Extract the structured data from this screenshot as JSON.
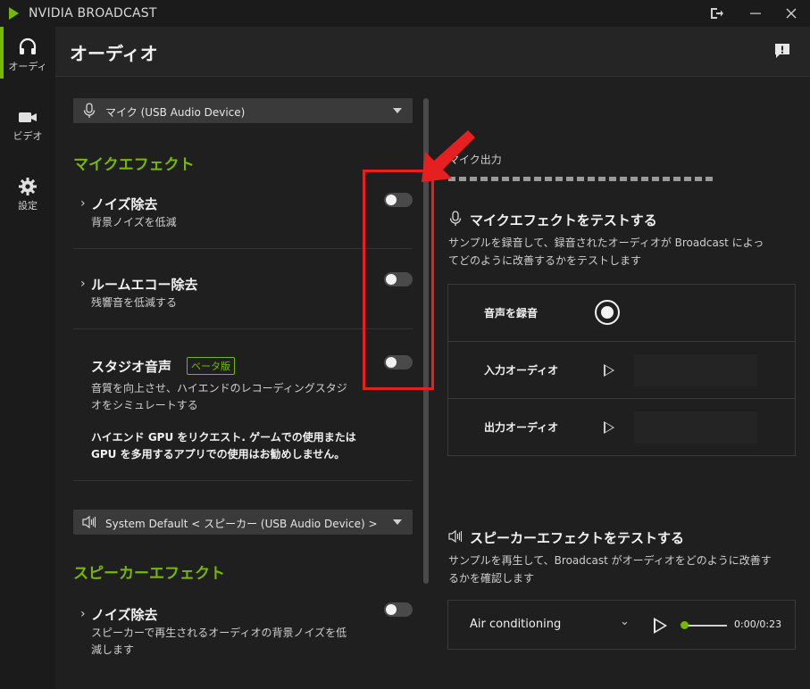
{
  "window": {
    "title": "NVIDIA BROADCAST"
  },
  "nav": {
    "items": [
      {
        "label": "オーディ",
        "icon": "headset-icon",
        "active": true
      },
      {
        "label": "ビデオ",
        "icon": "camera-icon",
        "active": false
      },
      {
        "label": "設定",
        "icon": "gear-icon",
        "active": false
      }
    ]
  },
  "header": {
    "title": "オーディオ"
  },
  "mic": {
    "device": "マイク (USB Audio Device)",
    "section_title": "マイクエフェクト",
    "effects": [
      {
        "name": "ノイズ除去",
        "desc": "背景ノイズを低減",
        "enabled": false
      },
      {
        "name": "ルームエコー除去",
        "desc": "残響音を低減する",
        "enabled": false
      },
      {
        "name": "スタジオ音声",
        "badge": "ベータ版",
        "desc1": "音質を向上させ、ハイエンドのレコーディングスタジ",
        "desc2": "オをシミュレートする",
        "warn1": "ハイエンド GPU をリクエスト. ゲームでの使用または",
        "warn2": "GPU を多用するアプリでの使用はお勧めしません。",
        "enabled": false
      }
    ]
  },
  "speaker": {
    "device": "System Default < スピーカー (USB Audio Device) >",
    "section_title": "スピーカーエフェクト",
    "effects": [
      {
        "name": "ノイズ除去",
        "desc1": "スピーカーで再生されるオーディオの背景ノイズを低",
        "desc2": "減します",
        "enabled": false
      }
    ]
  },
  "right": {
    "mic_output_label": "マイク出力",
    "mic_test": {
      "title": "マイクエフェクトをテストする",
      "desc1": "サンプルを録音して、録音されたオーディオが Broadcast によっ",
      "desc2": "てどのように改善するかをテストします",
      "rows": [
        {
          "label": "音声を録音"
        },
        {
          "label": "入力オーディオ"
        },
        {
          "label": "出力オーディオ"
        }
      ]
    },
    "speaker_test": {
      "title": "スピーカーエフェクトをテストする",
      "desc1": "サンプルを再生して、Broadcast がオーディオをどのように改善す",
      "desc2": "るかを確認します",
      "sample": "Air conditioning",
      "time": "0:00/0:23"
    }
  },
  "colors": {
    "accent": "#76b900",
    "annotation": "#e62020"
  }
}
